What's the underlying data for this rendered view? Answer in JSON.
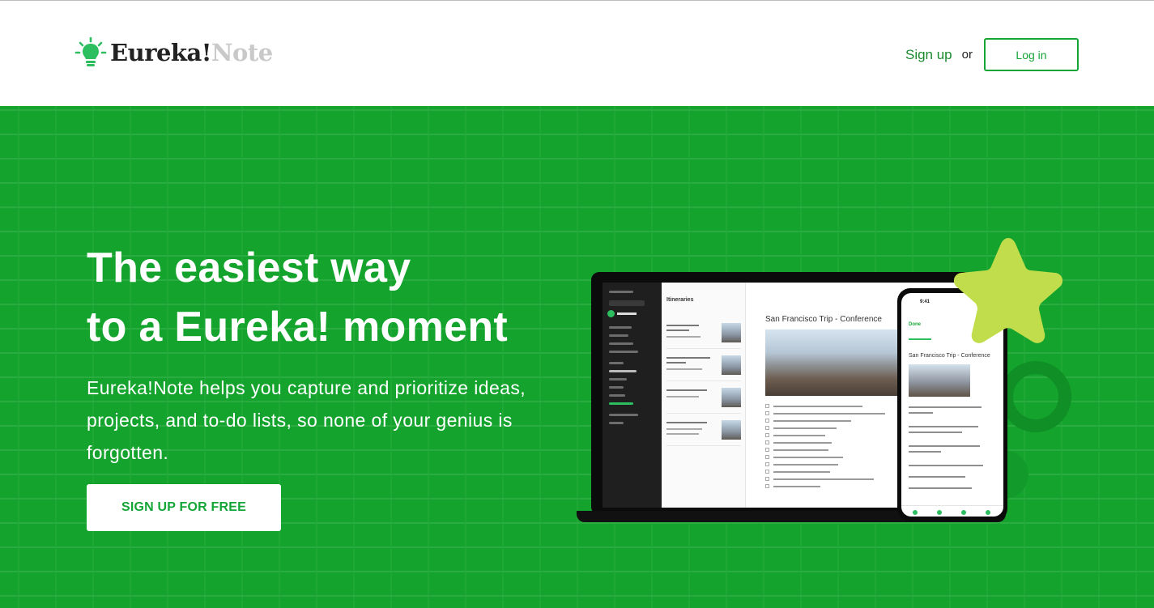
{
  "header": {
    "logo": {
      "word_1": "Eureka!",
      "word_2": "Note"
    },
    "nav": {
      "signup_label": "Sign up",
      "or_label": "or",
      "login_label": "Log in"
    }
  },
  "hero": {
    "title_line_1": "The easiest way",
    "title_line_2": "to a Eureka! moment",
    "subtitle": "Eureka!Note helps you capture and prioritize ideas, projects, and to-do lists, so none of your genius is forgotten.",
    "cta_label": "SIGN UP FOR FREE"
  },
  "illustration": {
    "list_header": "Itineraries",
    "note_title": "San Francisco Trip - Conference",
    "phone_title": "San Francisco Trip - Conference",
    "phone_done": "Done",
    "phone_time": "9:41"
  },
  "icons": {
    "logo": "lightbulb-icon",
    "decor_star": "star-icon"
  },
  "colors": {
    "brand_green": "#14a537",
    "hero_bg": "#14a42d",
    "star": "#c2dd4b"
  }
}
